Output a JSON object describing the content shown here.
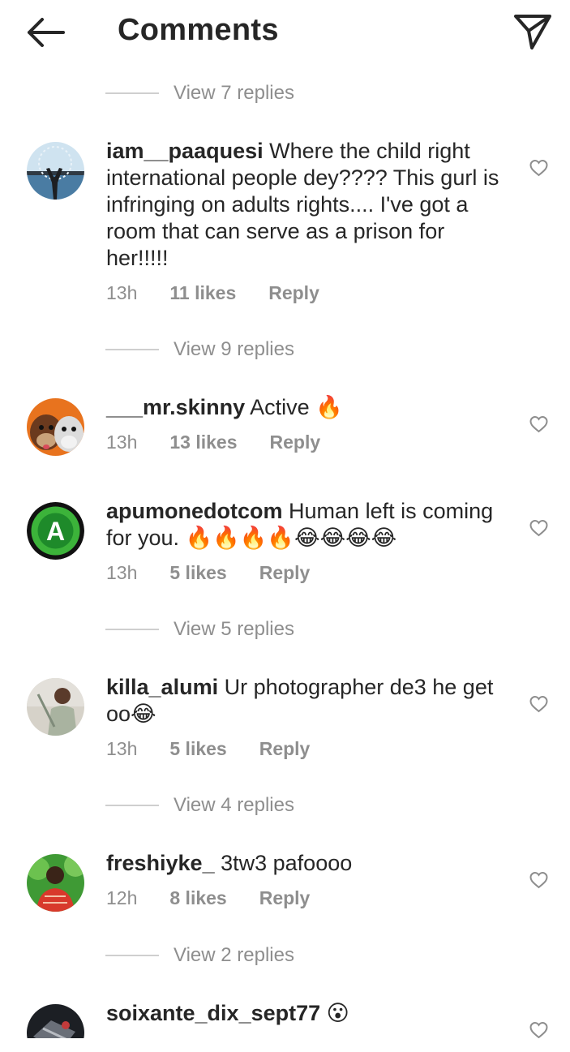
{
  "header": {
    "title": "Comments",
    "back_icon": "arrow-left-icon",
    "send_icon": "paper-plane-icon"
  },
  "view_replies": [
    "View 7 replies",
    "View 9 replies",
    "View 5 replies",
    "View 4 replies",
    "View 2 replies"
  ],
  "comments": [
    {
      "username": "iam__paaquesi",
      "text": "Where the child right international people dey???? This gurl is infringing on adults rights.... I've got a room that can serve as a prison for her!!!!!",
      "time": "13h",
      "likes": "11 likes",
      "reply": "Reply"
    },
    {
      "username": "___mr.skinny",
      "text": "Active 🔥",
      "time": "13h",
      "likes": "13 likes",
      "reply": "Reply"
    },
    {
      "username": "apumonedotcom",
      "text": "Human left is coming for you. 🔥🔥🔥🔥😂😂😂😂",
      "time": "13h",
      "likes": "5 likes",
      "reply": "Reply"
    },
    {
      "username": "killa_alumi",
      "text": "Ur photographer de3 he get oo😂",
      "time": "13h",
      "likes": "5 likes",
      "reply": "Reply"
    },
    {
      "username": "freshiyke_",
      "text": "3tw3 pafoooo",
      "time": "12h",
      "likes": "8 likes",
      "reply": "Reply"
    },
    {
      "username": "soixante_dix_sept77",
      "text": "😮",
      "time": "",
      "likes": "",
      "reply": ""
    }
  ],
  "colors": {
    "text": "#262626",
    "secondary": "#8e8e8e",
    "divider": "#cfcfcf"
  }
}
